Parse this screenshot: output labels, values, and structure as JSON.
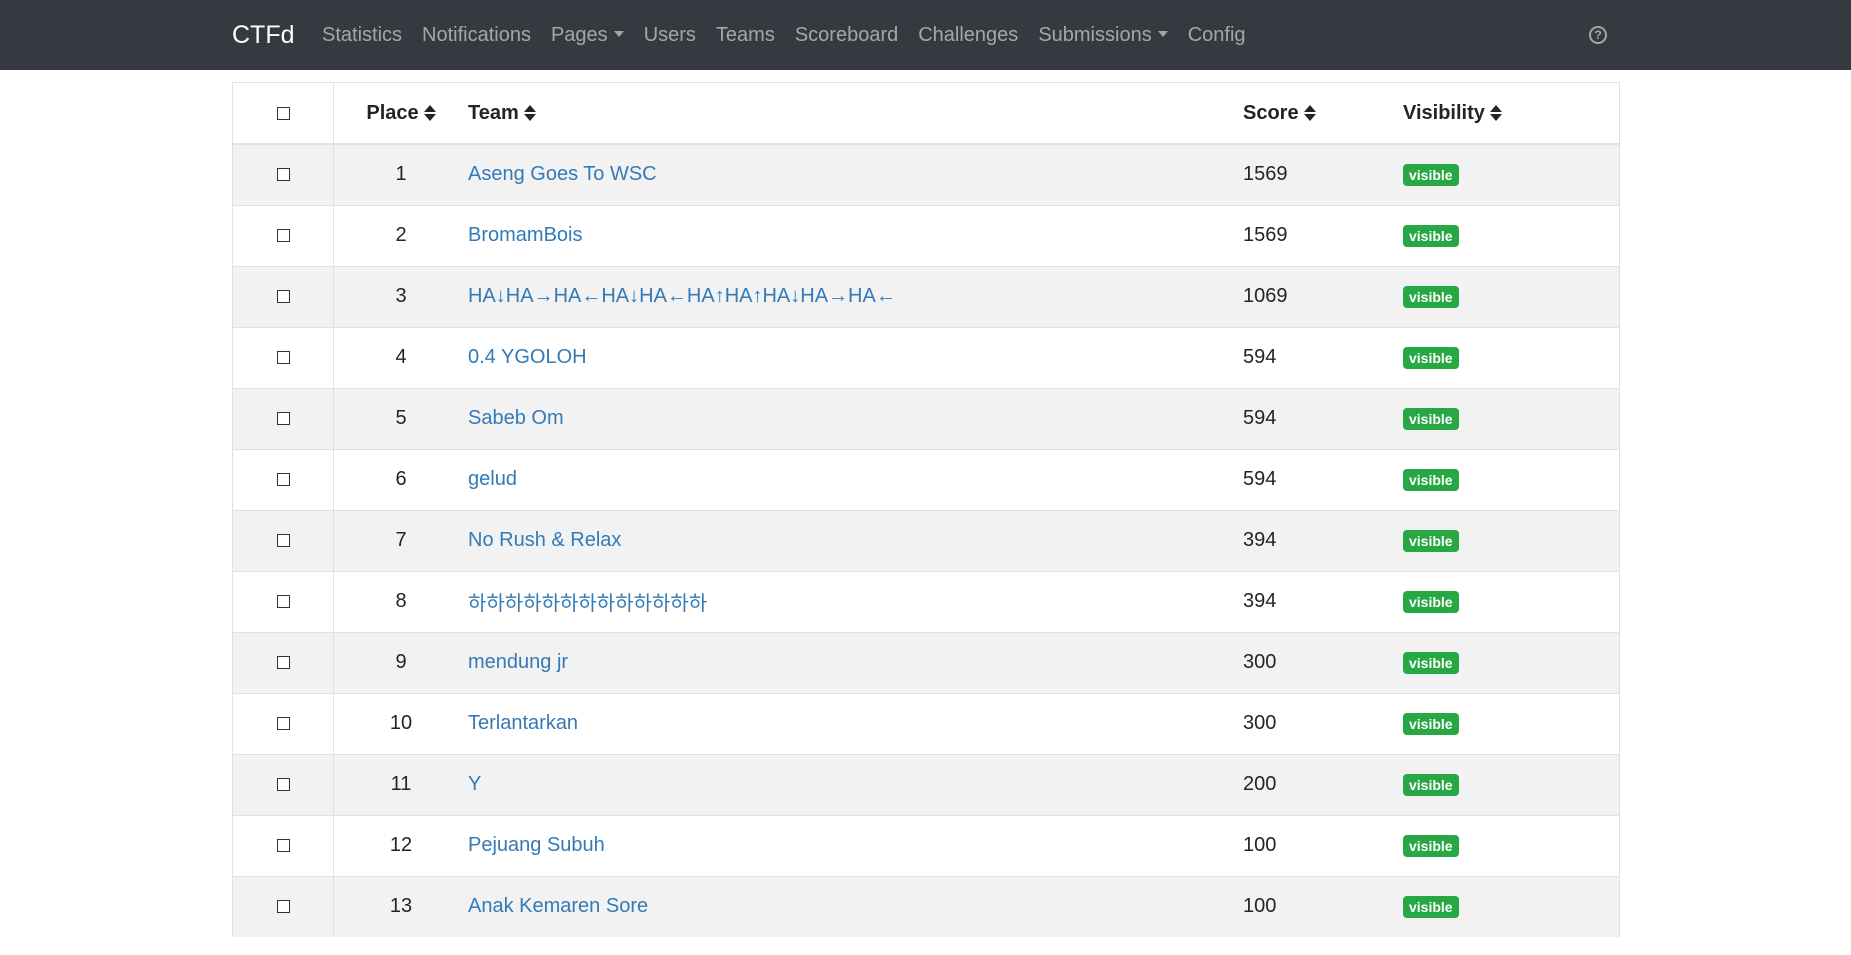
{
  "navbar": {
    "brand": "CTFd",
    "items": [
      {
        "label": "Statistics",
        "dropdown": false
      },
      {
        "label": "Notifications",
        "dropdown": false
      },
      {
        "label": "Pages",
        "dropdown": true
      },
      {
        "label": "Users",
        "dropdown": false
      },
      {
        "label": "Teams",
        "dropdown": false
      },
      {
        "label": "Scoreboard",
        "dropdown": false
      },
      {
        "label": "Challenges",
        "dropdown": false
      },
      {
        "label": "Submissions",
        "dropdown": true
      },
      {
        "label": "Config",
        "dropdown": false
      }
    ],
    "help_icon": "?"
  },
  "table": {
    "headers": {
      "place": "Place",
      "team": "Team",
      "score": "Score",
      "visibility": "Visibility"
    },
    "rows": [
      {
        "place": "1",
        "team": "Aseng Goes To WSC",
        "score": "1569",
        "visibility": "visible"
      },
      {
        "place": "2",
        "team": "BromamBois",
        "score": "1569",
        "visibility": "visible"
      },
      {
        "place": "3",
        "team": "HA↓HA→HA←HA↓HA←HA↑HA↑HA↓HA→HA←",
        "score": "1069",
        "visibility": "visible"
      },
      {
        "place": "4",
        "team": "0.4 YGOLOH",
        "score": "594",
        "visibility": "visible"
      },
      {
        "place": "5",
        "team": "Sabeb Om",
        "score": "594",
        "visibility": "visible"
      },
      {
        "place": "6",
        "team": "gelud",
        "score": "594",
        "visibility": "visible"
      },
      {
        "place": "7",
        "team": "No Rush & Relax",
        "score": "394",
        "visibility": "visible"
      },
      {
        "place": "8",
        "team": "하하하하하하하하하하하하하",
        "score": "394",
        "visibility": "visible"
      },
      {
        "place": "9",
        "team": "mendung jr",
        "score": "300",
        "visibility": "visible"
      },
      {
        "place": "10",
        "team": "Terlantarkan",
        "score": "300",
        "visibility": "visible"
      },
      {
        "place": "11",
        "team": "Y",
        "score": "200",
        "visibility": "visible"
      },
      {
        "place": "12",
        "team": "Pejuang Subuh",
        "score": "100",
        "visibility": "visible"
      },
      {
        "place": "13",
        "team": "Anak Kemaren Sore",
        "score": "100",
        "visibility": "visible"
      }
    ]
  },
  "colors": {
    "navbar_bg": "#343a40",
    "link": "#337ab7",
    "badge_visible": "#28a745"
  }
}
